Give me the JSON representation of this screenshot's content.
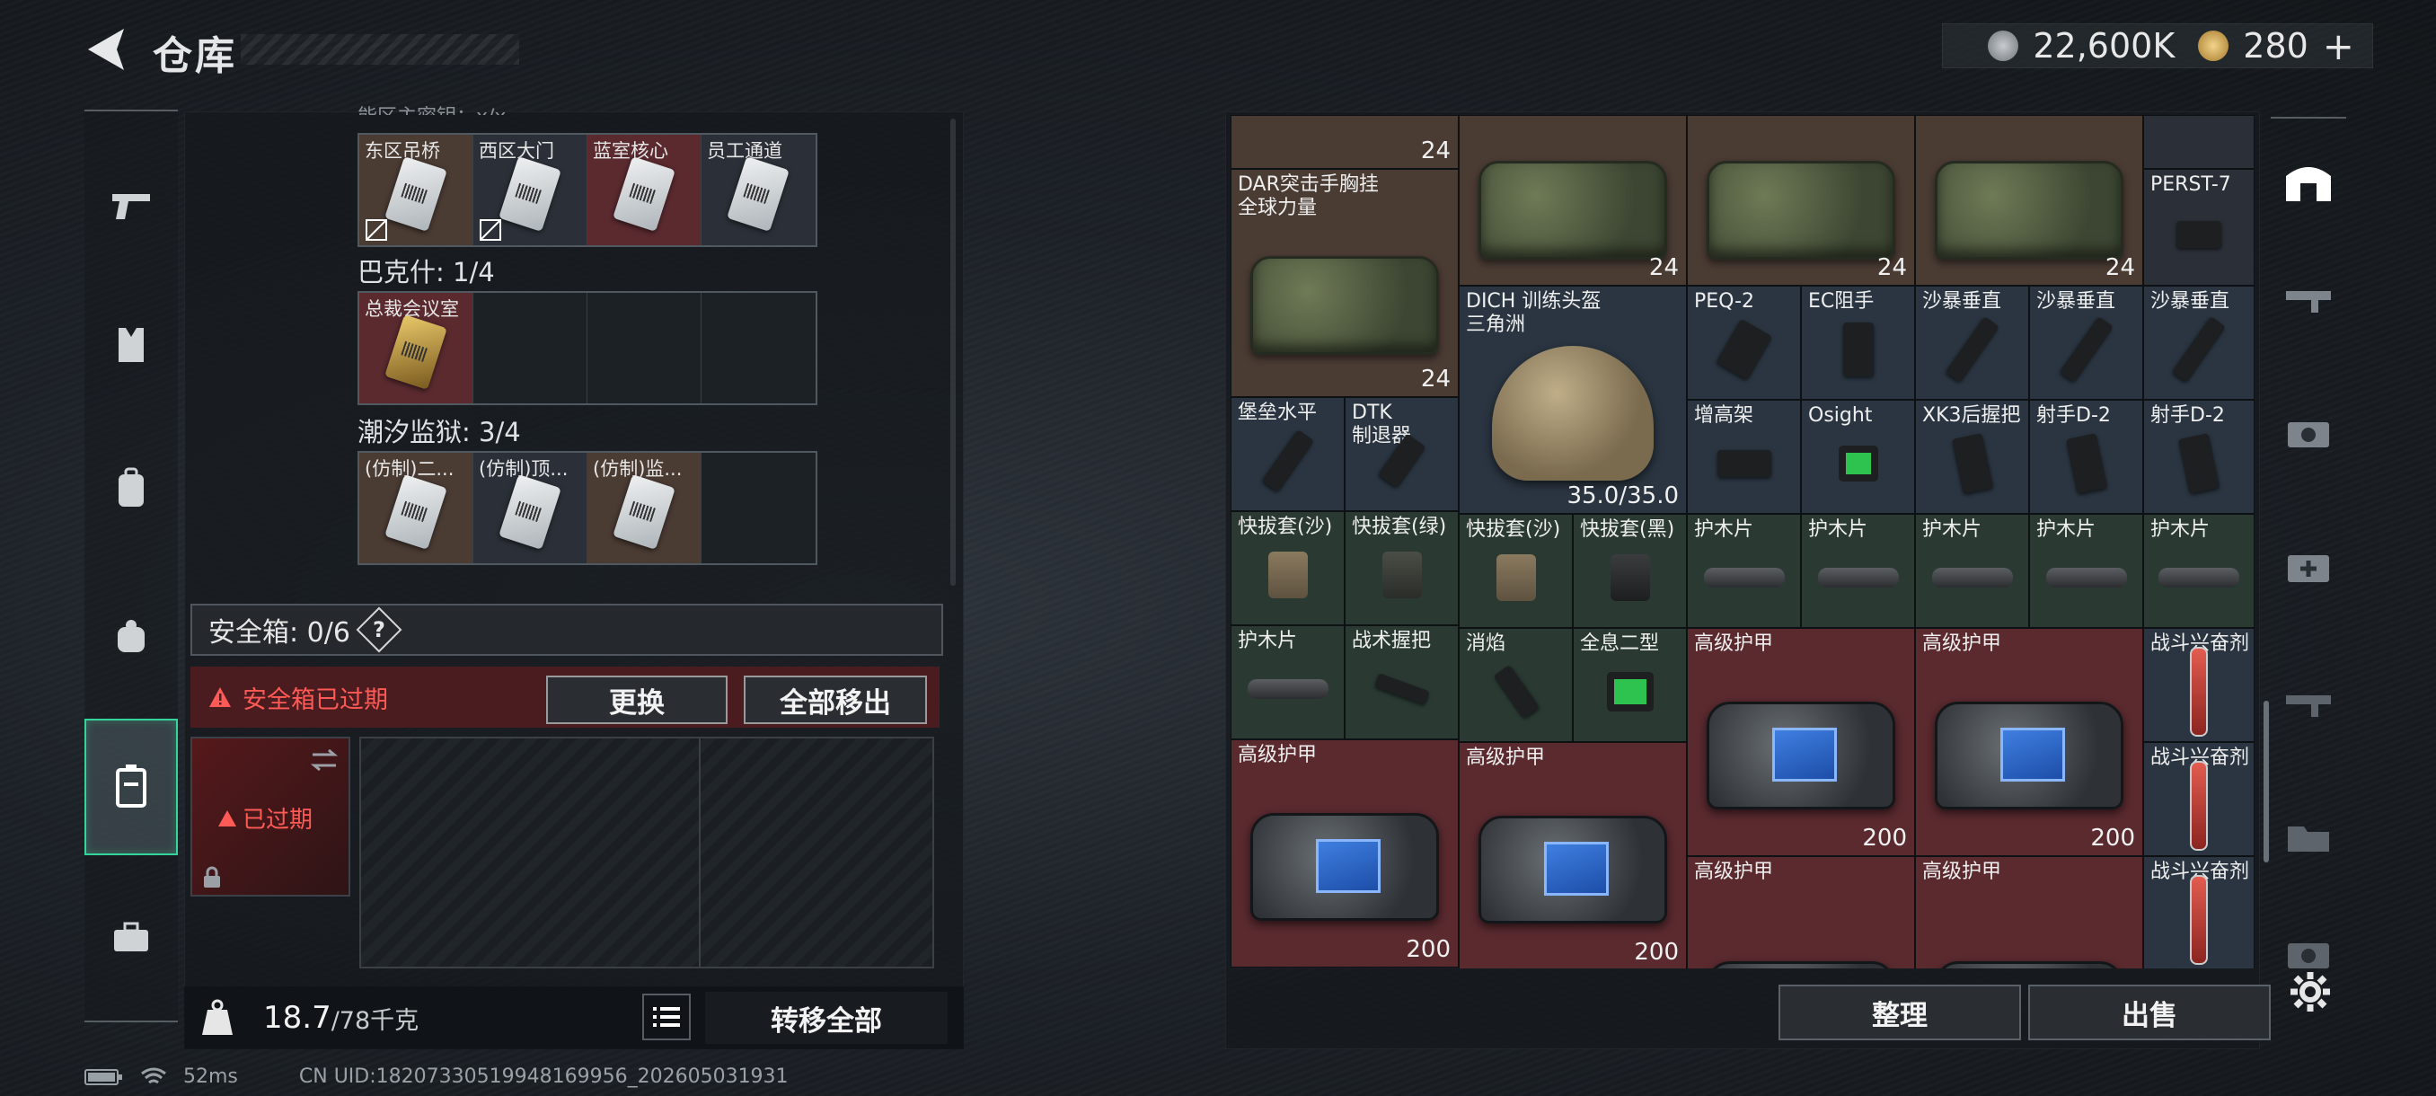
{
  "header": {
    "title": "仓库",
    "currency_1": "22,600K",
    "currency_2": "280",
    "plus": "+"
  },
  "left_panel": {
    "top_cut_text": "能区主密钥：x/x",
    "top_keys": [
      "东区吊桥",
      "西区大门",
      "蓝室核心",
      "员工通道"
    ],
    "section_2_title": "巴克什: 1/4",
    "section_2_keys": [
      "总裁会议室"
    ],
    "section_3_title": "潮汐监狱: 3/4",
    "section_3_keys": [
      "(仿制)二...",
      "(仿制)顶...",
      "(仿制)监..."
    ],
    "safe_box_label": "安全箱: 0/6",
    "help_label": "?",
    "expired_warning": "安全箱已过期",
    "replace_btn": "更换",
    "remove_all_btn": "全部移出",
    "expired_tag": "已过期",
    "weight_value": "18.7",
    "weight_unit": "/78千克",
    "transfer_all_btn": "转移全部"
  },
  "grid_items": {
    "c0": "24",
    "c1": "24",
    "c2": "24",
    "c3": "24",
    "perst": "PERST-7",
    "dar_name": "DAR突击手胸挂\n全球力量",
    "dar_count": "24",
    "dich_name": "DICH 训练头盔\n三角洲",
    "dich_dur": "35.0/35.0",
    "peq": "PEQ-2",
    "ec": "EC阻手",
    "sb1": "沙暴垂直",
    "sb2": "沙暴垂直",
    "sb3": "沙暴垂直",
    "bl": "堡垒水平",
    "dtk": "DTK\n制退器",
    "zgj": "增高架",
    "osight": "Osight",
    "xk3": "XK3后握把",
    "ssd1": "射手D-2",
    "ssd2": "射手D-2",
    "kbt1": "快拔套(沙)",
    "kbt2": "快拔套(绿)",
    "kbt3": "快拔套(沙)",
    "kbt4": "快拔套(黑)",
    "hmp1": "护木片",
    "hmp2": "护木片",
    "hmp3": "护木片",
    "hmp4": "护木片",
    "hmp5": "护木片",
    "hmp6": "护木片",
    "zswb": "战术握把",
    "xy": "消焰",
    "qxex": "全息二型",
    "armor_name": "高级护甲",
    "armor_val": "200",
    "stim": "战斗兴奋剂"
  },
  "right_buttons": {
    "sort": "整理",
    "sell": "出售"
  },
  "footer": {
    "ping": "52ms",
    "uid": "CN UID:18207330519948169956_202605031931"
  }
}
